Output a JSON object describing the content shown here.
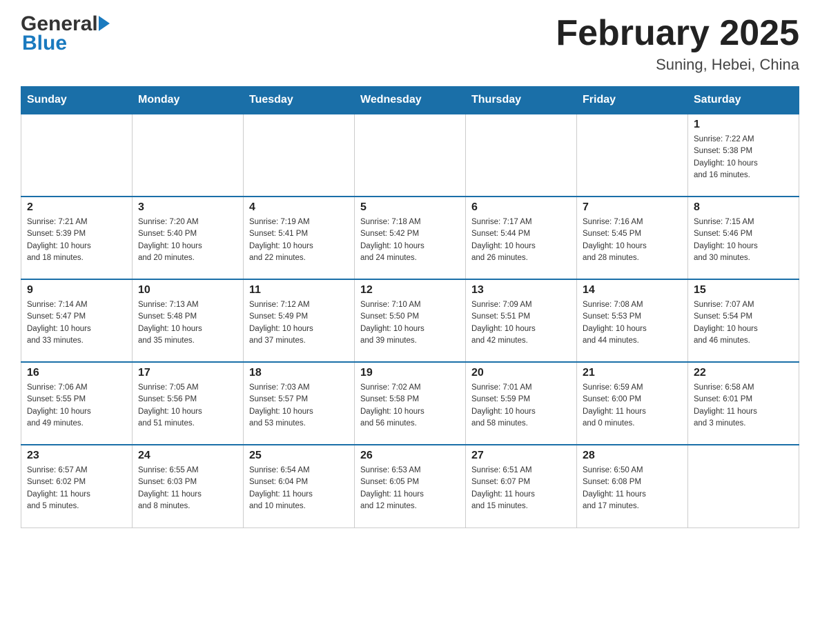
{
  "header": {
    "month_title": "February 2025",
    "location": "Suning, Hebei, China"
  },
  "logo": {
    "part1": "General",
    "part2": "Blue"
  },
  "days_of_week": [
    "Sunday",
    "Monday",
    "Tuesday",
    "Wednesday",
    "Thursday",
    "Friday",
    "Saturday"
  ],
  "weeks": [
    [
      {
        "day": "",
        "info": ""
      },
      {
        "day": "",
        "info": ""
      },
      {
        "day": "",
        "info": ""
      },
      {
        "day": "",
        "info": ""
      },
      {
        "day": "",
        "info": ""
      },
      {
        "day": "",
        "info": ""
      },
      {
        "day": "1",
        "info": "Sunrise: 7:22 AM\nSunset: 5:38 PM\nDaylight: 10 hours\nand 16 minutes."
      }
    ],
    [
      {
        "day": "2",
        "info": "Sunrise: 7:21 AM\nSunset: 5:39 PM\nDaylight: 10 hours\nand 18 minutes."
      },
      {
        "day": "3",
        "info": "Sunrise: 7:20 AM\nSunset: 5:40 PM\nDaylight: 10 hours\nand 20 minutes."
      },
      {
        "day": "4",
        "info": "Sunrise: 7:19 AM\nSunset: 5:41 PM\nDaylight: 10 hours\nand 22 minutes."
      },
      {
        "day": "5",
        "info": "Sunrise: 7:18 AM\nSunset: 5:42 PM\nDaylight: 10 hours\nand 24 minutes."
      },
      {
        "day": "6",
        "info": "Sunrise: 7:17 AM\nSunset: 5:44 PM\nDaylight: 10 hours\nand 26 minutes."
      },
      {
        "day": "7",
        "info": "Sunrise: 7:16 AM\nSunset: 5:45 PM\nDaylight: 10 hours\nand 28 minutes."
      },
      {
        "day": "8",
        "info": "Sunrise: 7:15 AM\nSunset: 5:46 PM\nDaylight: 10 hours\nand 30 minutes."
      }
    ],
    [
      {
        "day": "9",
        "info": "Sunrise: 7:14 AM\nSunset: 5:47 PM\nDaylight: 10 hours\nand 33 minutes."
      },
      {
        "day": "10",
        "info": "Sunrise: 7:13 AM\nSunset: 5:48 PM\nDaylight: 10 hours\nand 35 minutes."
      },
      {
        "day": "11",
        "info": "Sunrise: 7:12 AM\nSunset: 5:49 PM\nDaylight: 10 hours\nand 37 minutes."
      },
      {
        "day": "12",
        "info": "Sunrise: 7:10 AM\nSunset: 5:50 PM\nDaylight: 10 hours\nand 39 minutes."
      },
      {
        "day": "13",
        "info": "Sunrise: 7:09 AM\nSunset: 5:51 PM\nDaylight: 10 hours\nand 42 minutes."
      },
      {
        "day": "14",
        "info": "Sunrise: 7:08 AM\nSunset: 5:53 PM\nDaylight: 10 hours\nand 44 minutes."
      },
      {
        "day": "15",
        "info": "Sunrise: 7:07 AM\nSunset: 5:54 PM\nDaylight: 10 hours\nand 46 minutes."
      }
    ],
    [
      {
        "day": "16",
        "info": "Sunrise: 7:06 AM\nSunset: 5:55 PM\nDaylight: 10 hours\nand 49 minutes."
      },
      {
        "day": "17",
        "info": "Sunrise: 7:05 AM\nSunset: 5:56 PM\nDaylight: 10 hours\nand 51 minutes."
      },
      {
        "day": "18",
        "info": "Sunrise: 7:03 AM\nSunset: 5:57 PM\nDaylight: 10 hours\nand 53 minutes."
      },
      {
        "day": "19",
        "info": "Sunrise: 7:02 AM\nSunset: 5:58 PM\nDaylight: 10 hours\nand 56 minutes."
      },
      {
        "day": "20",
        "info": "Sunrise: 7:01 AM\nSunset: 5:59 PM\nDaylight: 10 hours\nand 58 minutes."
      },
      {
        "day": "21",
        "info": "Sunrise: 6:59 AM\nSunset: 6:00 PM\nDaylight: 11 hours\nand 0 minutes."
      },
      {
        "day": "22",
        "info": "Sunrise: 6:58 AM\nSunset: 6:01 PM\nDaylight: 11 hours\nand 3 minutes."
      }
    ],
    [
      {
        "day": "23",
        "info": "Sunrise: 6:57 AM\nSunset: 6:02 PM\nDaylight: 11 hours\nand 5 minutes."
      },
      {
        "day": "24",
        "info": "Sunrise: 6:55 AM\nSunset: 6:03 PM\nDaylight: 11 hours\nand 8 minutes."
      },
      {
        "day": "25",
        "info": "Sunrise: 6:54 AM\nSunset: 6:04 PM\nDaylight: 11 hours\nand 10 minutes."
      },
      {
        "day": "26",
        "info": "Sunrise: 6:53 AM\nSunset: 6:05 PM\nDaylight: 11 hours\nand 12 minutes."
      },
      {
        "day": "27",
        "info": "Sunrise: 6:51 AM\nSunset: 6:07 PM\nDaylight: 11 hours\nand 15 minutes."
      },
      {
        "day": "28",
        "info": "Sunrise: 6:50 AM\nSunset: 6:08 PM\nDaylight: 11 hours\nand 17 minutes."
      },
      {
        "day": "",
        "info": ""
      }
    ]
  ]
}
